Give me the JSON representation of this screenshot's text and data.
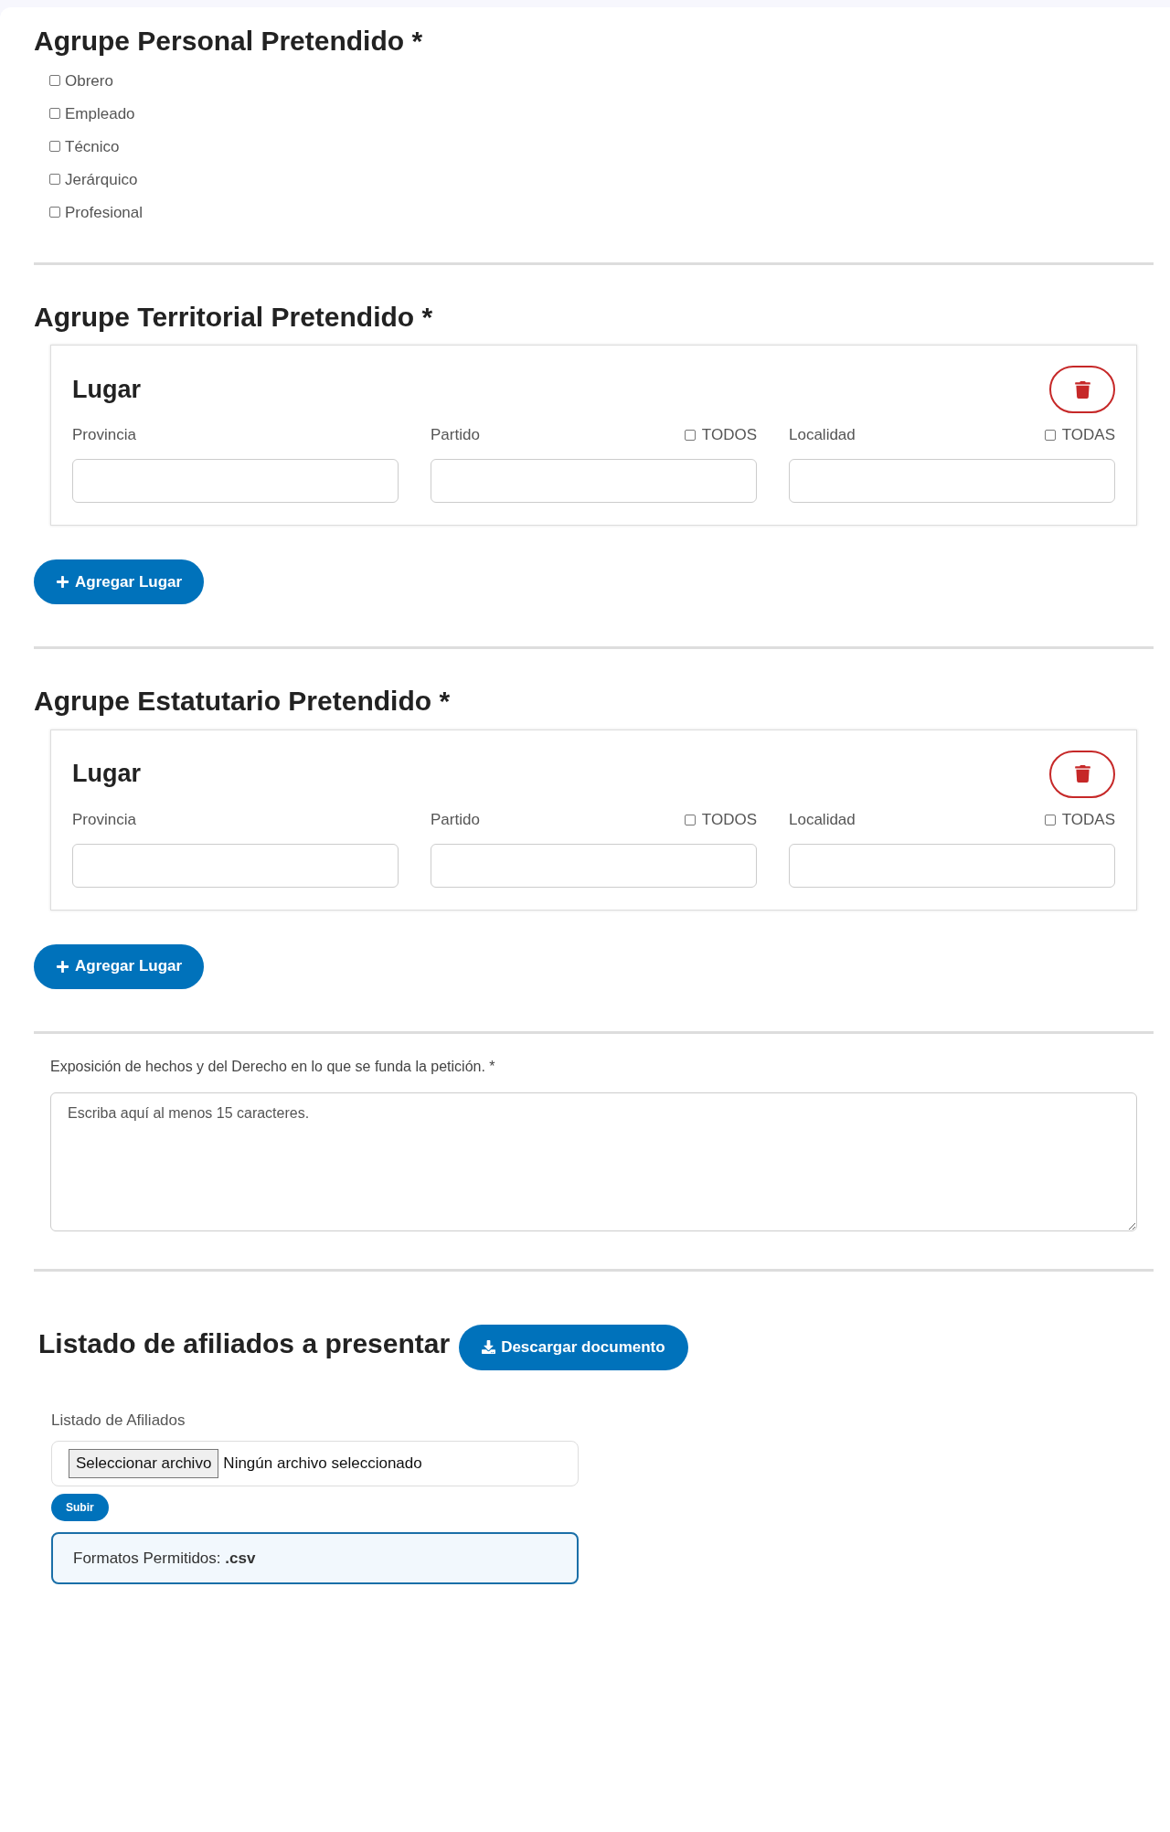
{
  "sections": [
    {
      "kind": "checkboxes",
      "title": "Agrupe Personal Pretendido *",
      "options": [
        {
          "label": "Obrero",
          "checked": false
        },
        {
          "label": "Empleado",
          "checked": false
        },
        {
          "label": "Técnico",
          "checked": false
        },
        {
          "label": "Jerárquico",
          "checked": false
        },
        {
          "label": "Profesional",
          "checked": false
        }
      ]
    },
    {
      "kind": "places",
      "title": "Agrupe Territorial Pretendido *",
      "places": [
        {
          "title": "Lugar",
          "fields": [
            {
              "label": "Provincia"
            },
            {
              "label": "Partido",
              "toggle": {
                "label": "TODOS",
                "checked": false
              }
            },
            {
              "label": "Localidad",
              "toggle": {
                "label": "TODAS",
                "checked": false
              }
            }
          ]
        }
      ],
      "add_button": "Agregar Lugar"
    },
    {
      "kind": "places",
      "title": "Agrupe Estatutario Pretendido *",
      "places": [
        {
          "title": "Lugar",
          "fields": [
            {
              "label": "Provincia"
            },
            {
              "label": "Partido",
              "toggle": {
                "label": "TODOS",
                "checked": false
              }
            },
            {
              "label": "Localidad",
              "toggle": {
                "label": "TODAS",
                "checked": false
              }
            }
          ]
        }
      ],
      "add_button": "Agregar Lugar"
    },
    {
      "kind": "textarea",
      "label": "Exposición de hechos y del Derecho en lo que se funda la petición. *",
      "placeholder": "Escriba aquí al menos 15 caracteres."
    },
    {
      "kind": "upload",
      "title": "Listado de afiliados a presentar",
      "download_button": "Descargar documento",
      "field_label": "Listado de Afiliados",
      "choose_button": "Seleccionar archivo",
      "file_status": "Ningún archivo seleccionado",
      "submit_button": "Subir",
      "note": "Formatos Permitidos: **.csv**"
    }
  ]
}
